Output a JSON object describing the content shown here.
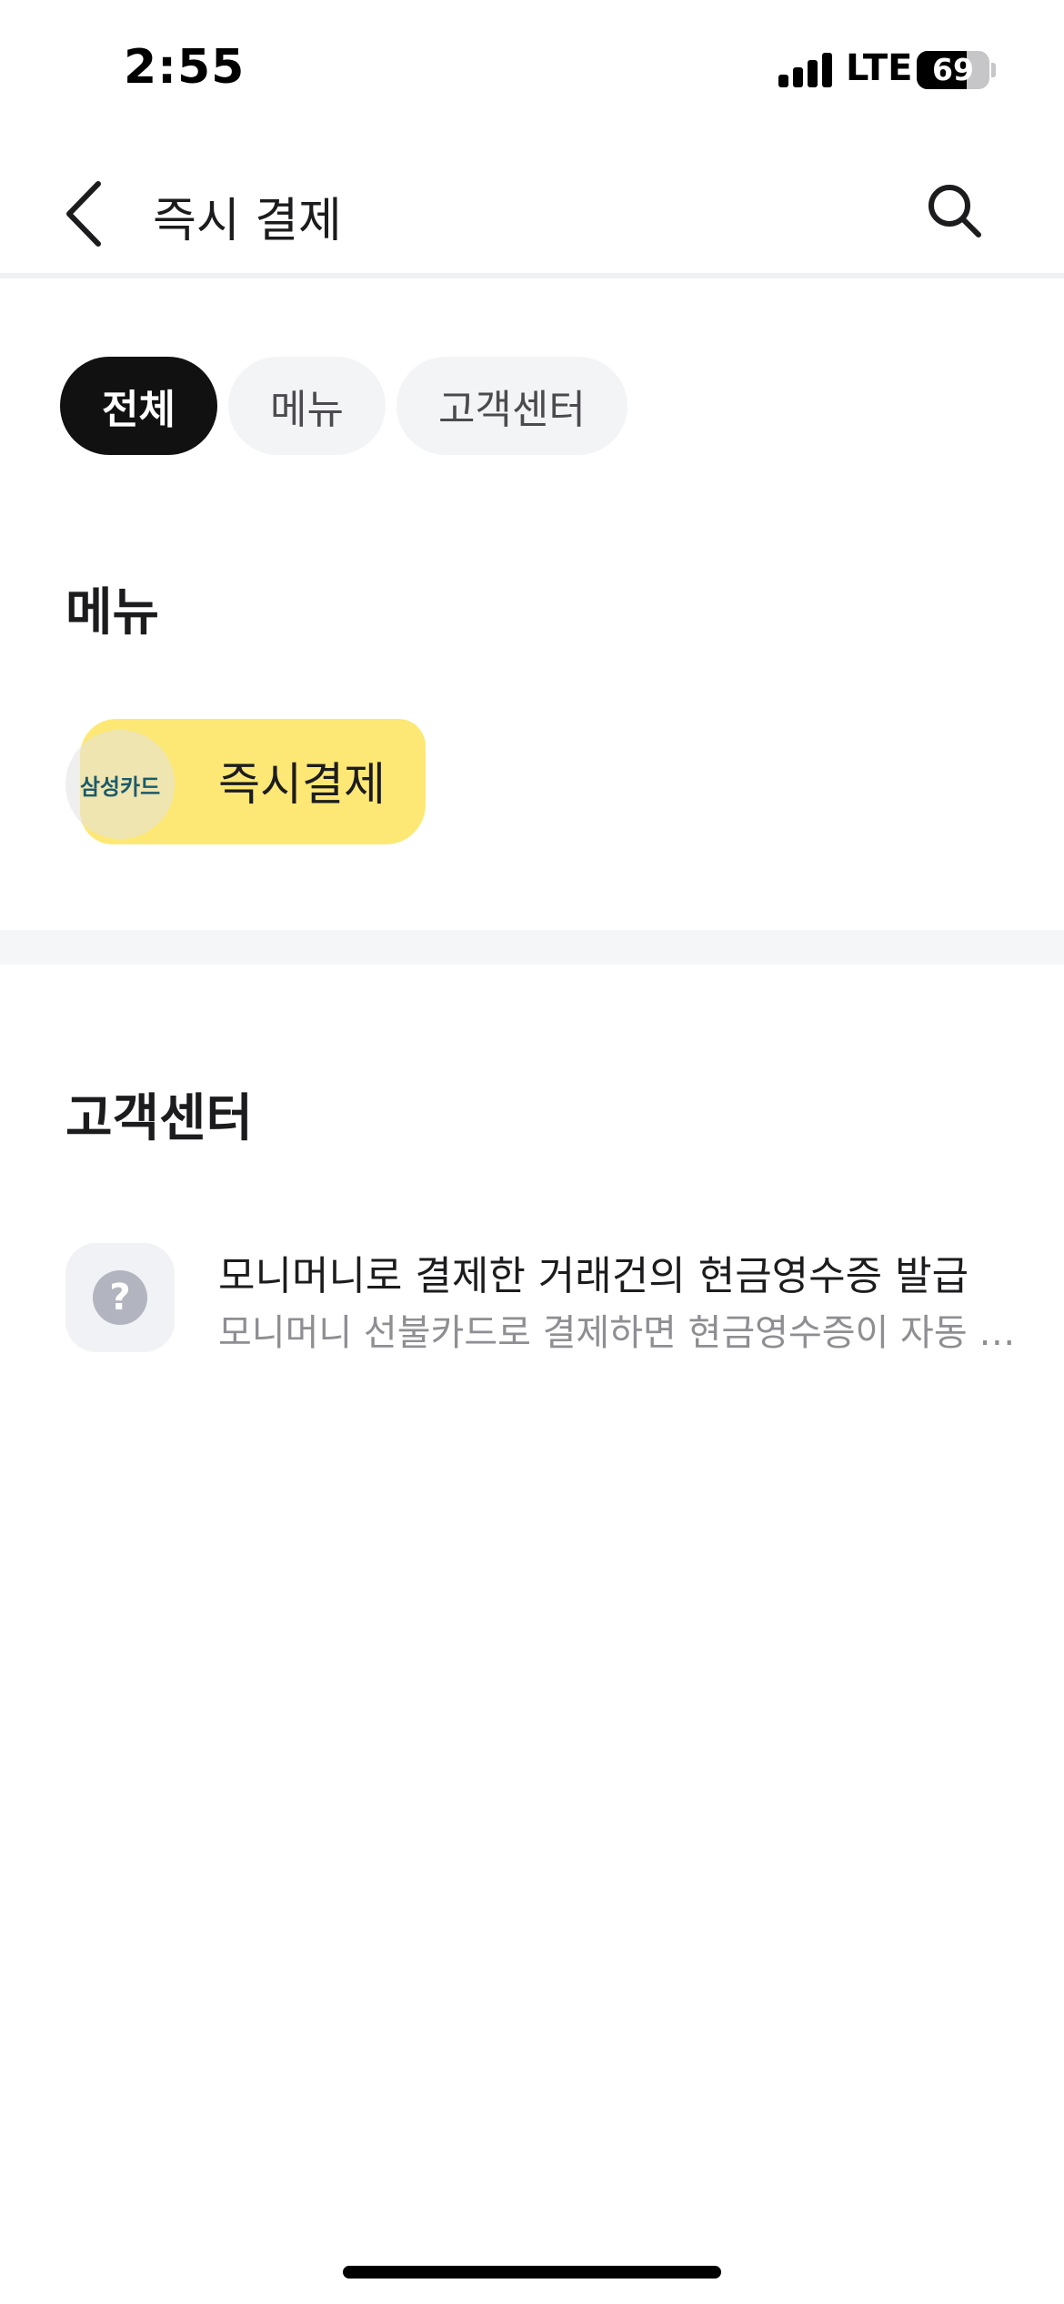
{
  "status_bar": {
    "time": "2:55",
    "network": "LTE",
    "battery_percent": "69",
    "battery_level": 0.69
  },
  "header": {
    "title": "즉시 결제",
    "back_icon": "chevron-left-icon",
    "search_icon": "search-icon"
  },
  "tabs": [
    {
      "label": "전체",
      "active": true
    },
    {
      "label": "메뉴",
      "active": false
    },
    {
      "label": "고객센터",
      "active": false
    }
  ],
  "menu_section": {
    "title": "메뉴",
    "items": [
      {
        "logo_text": "삼성카드",
        "label": "즉시결제"
      }
    ]
  },
  "support_section": {
    "title": "고객센터",
    "items": [
      {
        "icon": "question-icon",
        "title": "모니머니로 결제한 거래건의 현금영수증 발급",
        "subtitle": "모니머니 선불카드로 결제하면 현금영수증이 자동 발급됩니다"
      }
    ]
  },
  "colors": {
    "active_chip": "#111111",
    "inactive_chip": "#f3f4f6",
    "highlight": "#fde666",
    "secondary_text": "#8e8e93"
  }
}
